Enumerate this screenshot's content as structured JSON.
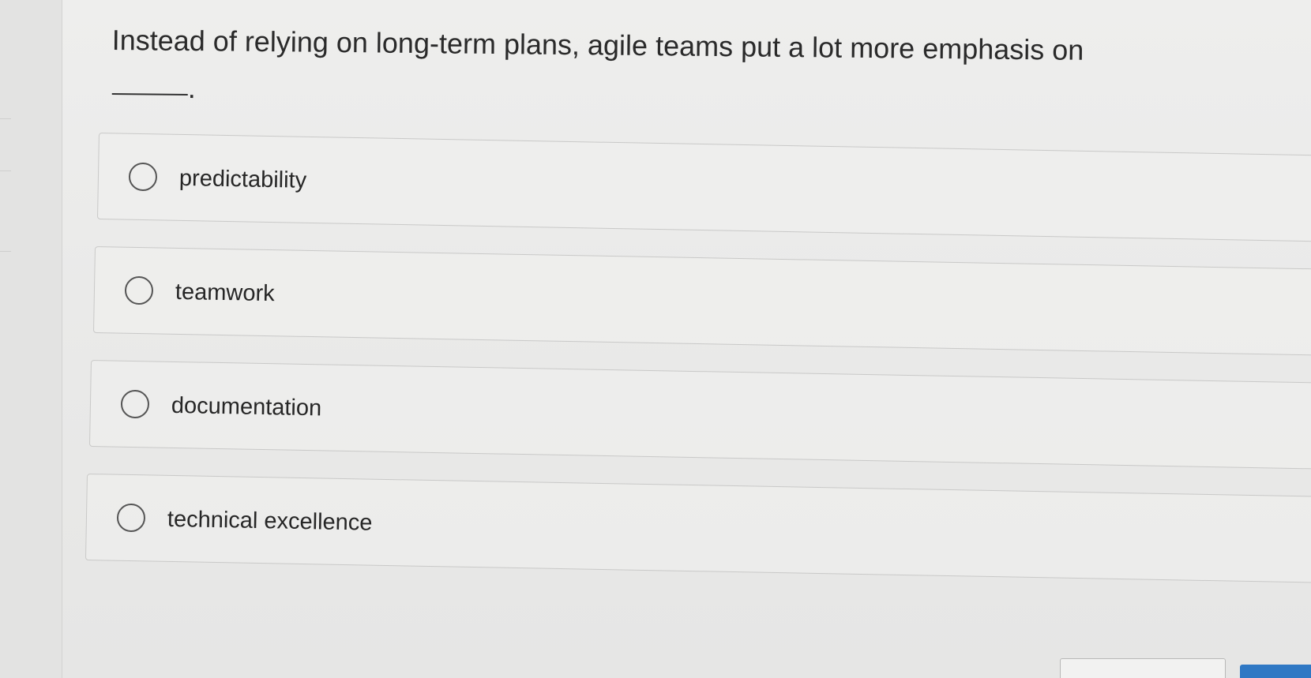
{
  "question": {
    "text": "Instead of relying on long-term plans, agile teams put a lot more emphasis on",
    "blank_suffix": "."
  },
  "options": [
    {
      "label": "predictability",
      "selected": false
    },
    {
      "label": "teamwork",
      "selected": false
    },
    {
      "label": "documentation",
      "selected": false
    },
    {
      "label": "technical excellence",
      "selected": false
    }
  ],
  "colors": {
    "background": "#ebebea",
    "border": "#c9c9c8",
    "primary_button": "#2f78c4"
  }
}
